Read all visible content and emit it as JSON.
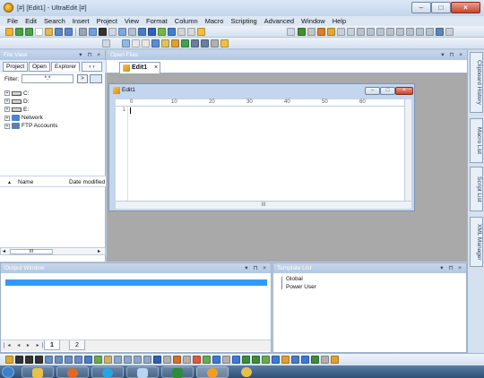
{
  "window": {
    "title": "[#] [Edit1] - UltraEdit [#]"
  },
  "menubar": [
    "File",
    "Edit",
    "Search",
    "Insert",
    "Project",
    "View",
    "Format",
    "Column",
    "Macro",
    "Scripting",
    "Advanced",
    "Window",
    "Help"
  ],
  "file_view": {
    "title": "File View",
    "controls": "▾ ⊓ ×",
    "tabs": [
      "Project",
      "Open",
      "Explorer"
    ],
    "tab_arrows": "‹ ›",
    "filter_label": "Filter:",
    "filter_value": "*.*",
    "filter_go": ">",
    "tree": [
      {
        "expander": "+",
        "label": "C:"
      },
      {
        "expander": "+",
        "label": "D:"
      },
      {
        "expander": "+",
        "label": "E:"
      },
      {
        "expander": "+",
        "label": "Network"
      },
      {
        "expander": "+",
        "label": "FTP Accounts"
      }
    ],
    "list_columns": [
      "Name",
      "Date modified"
    ],
    "sort_arrow": "▲",
    "scroll_left": "◂",
    "scroll_right": "▸",
    "scroll_thumb": "III"
  },
  "open_files": {
    "title": "Open Files",
    "controls": "▾ ⊓ ×",
    "tab_label": "Edit1",
    "tab_close": "×"
  },
  "editor": {
    "title": "Edit1",
    "line_number": "1",
    "ruler": [
      "0",
      "10",
      "20",
      "30",
      "40",
      "50",
      "60"
    ],
    "hscroll_thumb": "III",
    "min_glyph": "–",
    "max_glyph": "□",
    "close_glyph": "×"
  },
  "right_dock": [
    "Clipboard History",
    "Macro List",
    "Script List",
    "XML Manager"
  ],
  "output_window": {
    "title": "Output Window",
    "controls": "▾ ⊓ ×",
    "tabs": [
      "1",
      "2"
    ],
    "nav": "|◂ ◂ ▸ ▸|"
  },
  "template_list": {
    "title": "Template List",
    "controls": "▾ ⊓ ×",
    "items": [
      "Global",
      "Power User"
    ]
  },
  "title_buttons": {
    "min": "–",
    "max": "□",
    "close": "×"
  },
  "colors": {
    "selection": "#3399ff",
    "editor_bg": "#a9a9a9",
    "pane_title": "#b2c7e2",
    "taskbar": "#2f4e74"
  }
}
